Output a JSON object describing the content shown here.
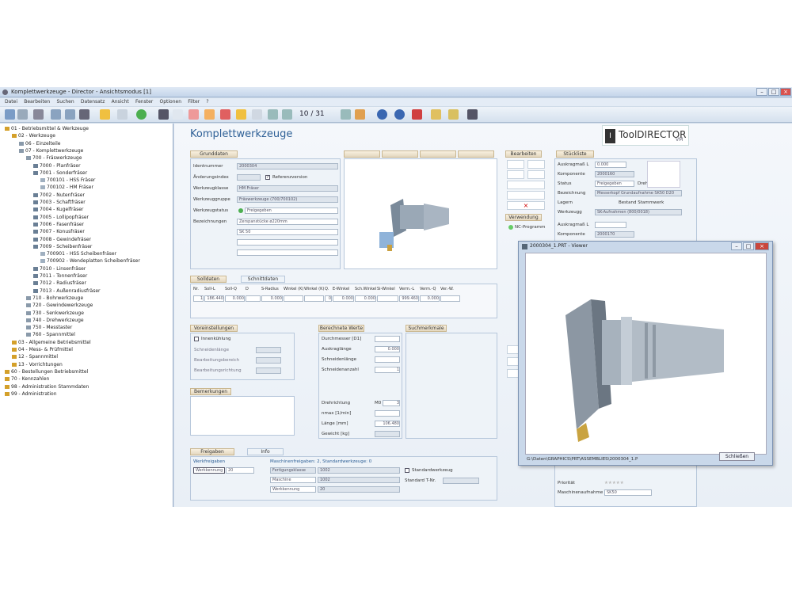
{
  "window": {
    "title": "Komplettwerkzeuge - Director - Ansichtsmodus [1]"
  },
  "menu": [
    "Datei",
    "Bearbeiten",
    "Suchen",
    "Datensatz",
    "Ansicht",
    "Fenster",
    "Optionen",
    "Filter",
    "?"
  ],
  "pager": "10 / 31",
  "tree": [
    {
      "label": "01 - Betriebsmittel & Werkzeuge",
      "lvl": 0
    },
    {
      "label": "02 - Werkzeuge",
      "lvl": 1
    },
    {
      "label": "06 - Einzelteile",
      "lvl": 2
    },
    {
      "label": "07 - Komplettwerkzeuge",
      "lvl": 2
    },
    {
      "label": "700 - Fräswerkzeuge",
      "lvl": 3
    },
    {
      "label": "7000 - Planfräser",
      "lvl": 4
    },
    {
      "label": "7001 - Sonderfräser",
      "lvl": 4
    },
    {
      "label": "700101 - HSS Fräser",
      "lvl": 5
    },
    {
      "label": "700102 - HM Fräser",
      "lvl": 5
    },
    {
      "label": "7002 - Nutenfräser",
      "lvl": 4
    },
    {
      "label": "7003 - Schaftfräser",
      "lvl": 4
    },
    {
      "label": "7004 - Kugelfräser",
      "lvl": 4
    },
    {
      "label": "7005 - Lollipopfräser",
      "lvl": 4
    },
    {
      "label": "7006 - Fasenfräser",
      "lvl": 4
    },
    {
      "label": "7007 - Konusfräser",
      "lvl": 4
    },
    {
      "label": "7008 - Gewindefräser",
      "lvl": 4
    },
    {
      "label": "7009 - Scheibenfräser",
      "lvl": 4
    },
    {
      "label": "700901 - HSS Scheibenfräser",
      "lvl": 5
    },
    {
      "label": "700902 - Wendeplatten Scheibenfräser",
      "lvl": 5
    },
    {
      "label": "7010 - Linsenfräser",
      "lvl": 4
    },
    {
      "label": "7011 - Tonnenfräser",
      "lvl": 4
    },
    {
      "label": "7012 - Radiusfräser",
      "lvl": 4
    },
    {
      "label": "7013 - Außenradiusfräser",
      "lvl": 4
    },
    {
      "label": "710 - Bohrwerkzeuge",
      "lvl": 3
    },
    {
      "label": "720 - Gewindewerkzeuge",
      "lvl": 3
    },
    {
      "label": "730 - Senkwerkzeuge",
      "lvl": 3
    },
    {
      "label": "740 - Drehwerkzeuge",
      "lvl": 3
    },
    {
      "label": "750 - Messtaster",
      "lvl": 3
    },
    {
      "label": "760 - Spannmittel",
      "lvl": 3
    },
    {
      "label": "03 - Allgemeine Betriebsmittel",
      "lvl": 1
    },
    {
      "label": "04 - Mess- & Prüfmittel",
      "lvl": 1
    },
    {
      "label": "12 - Spannmittel",
      "lvl": 1
    },
    {
      "label": "13 - Vorrichtungen",
      "lvl": 1
    },
    {
      "label": "60 - Bestellungen Betriebsmittel",
      "lvl": 0
    },
    {
      "label": "70 - Kennzahlen",
      "lvl": 0
    },
    {
      "label": "98 - Administration Stammdaten",
      "lvl": 0
    },
    {
      "label": "99 - Administration",
      "lvl": 0
    }
  ],
  "main": {
    "heading": "Komplettwerkzeuge",
    "logo": {
      "brand": "ToolDIRECTOR",
      "suffix": "VM"
    },
    "grunddaten": {
      "tab": "Grunddaten",
      "fields": [
        {
          "label": "Identnummer",
          "value": "2000304"
        },
        {
          "label": "Änderungsindex",
          "value": ""
        },
        {
          "label": "Werkzeugklasse",
          "value": "HM Fräser"
        },
        {
          "label": "Werkzeuggruppe",
          "value": "Fräswerkzeuge (700/700102)"
        },
        {
          "label": "Werkzeugstatus",
          "value": "Freigegeben"
        },
        {
          "label": "Bezeichnungen",
          "value": "Zerspanstücke ø220mm"
        }
      ],
      "sk": "SK 50",
      "ref": "Referenzversion"
    },
    "soll": {
      "tabs": [
        "Solldaten",
        "Schnittdaten"
      ],
      "headers": [
        "Nr.",
        "Soll-L",
        "Soll-Q",
        "D",
        "S-Radius",
        "Winkel (K)",
        "Winkel (K)",
        "Q.",
        "E-Winkel",
        "Sch.Winkel",
        "Si-Winkel",
        "Verm.-L",
        "Verm.-Q",
        "Ver.-W."
      ],
      "row": [
        "1",
        "186.440",
        "0.000",
        "",
        "0.000",
        "",
        "",
        "0",
        "0.000",
        "0.000",
        "",
        "999.460",
        "0.000",
        ""
      ]
    },
    "voreinst": {
      "tab": "Voreinstellungen",
      "check": "Innenkühlung",
      "rows": [
        "Schneidenlänge",
        "Bearbeitungsbereich",
        "Bearbeitungsrichtung"
      ]
    },
    "berechnete": {
      "tab": "Berechnete Werte",
      "rows": [
        {
          "label": "Durchmesser [D1]",
          "value": ""
        },
        {
          "label": "Auskraglänge",
          "value": "0.000"
        },
        {
          "label": "Schneidenlänge",
          "value": ""
        },
        {
          "label": "Schneidenanzahl",
          "value": "1"
        }
      ],
      "rows2": [
        {
          "label": "Drehrichtung",
          "value": "3",
          "pre": "M0"
        },
        {
          "label": "nmax [1/min]",
          "value": ""
        },
        {
          "label": "Länge [mm]",
          "value": "106.480"
        },
        {
          "label": "Gewicht [kg]",
          "value": ""
        }
      ]
    },
    "suchmerkmale": {
      "tab": "Suchmerkmale"
    },
    "bemerkungen": {
      "tab": "Bemerkungen"
    },
    "freigaben": {
      "tabs": [
        "Freigaben",
        "Info"
      ],
      "left": "Werkfreigaben",
      "col": "Werkkennung",
      "val": "20",
      "info": "Maschinenfreigaben: 2, Standardwerkzeuge: 0",
      "rows": [
        {
          "label": "Fertigungsklasse",
          "value": "1002"
        },
        {
          "label": "Maschine",
          "value": "1002"
        },
        {
          "label": "Werkkennung",
          "value": "20"
        }
      ],
      "std": "Standardwerkzeug",
      "stdt": "Standard T-Nr."
    },
    "bearbeiten": {
      "tab": "Bearbeiten",
      "verwendung": "Verwendung",
      "nc": "NC-Programm"
    },
    "stueckliste": {
      "tab": "Stückliste",
      "rows": [
        {
          "label": "Auskragmaß L",
          "value": "0.000"
        },
        {
          "label": "Komponente",
          "value": "2000160"
        },
        {
          "label": "Status",
          "value": "Freigegeben"
        },
        {
          "label": "Bezeichnung",
          "value": "Messerkopf Grundaufnahme SK50 D20"
        },
        {
          "label": "Lagern",
          "value": "Bestand Stammwerk"
        },
        {
          "label": "Werkzeugg",
          "value": "SK-Aufnahmen (800/0018)"
        }
      ],
      "rows2": [
        {
          "label": "Auskragmaß L",
          "value": ""
        },
        {
          "label": "Komponente",
          "value": "2000170"
        }
      ],
      "drehen": "Drehen",
      "prio": "Priorität",
      "ma": "Maschinenaufnahme",
      "maval": "SK50"
    }
  },
  "viewer": {
    "title": "2000304_1.PRT - Viewer",
    "path": "G:\\Daten\\GRAPHICS\\PRT\\ASSEMBLIES\\2000304_1.P",
    "close": "Schließen"
  }
}
